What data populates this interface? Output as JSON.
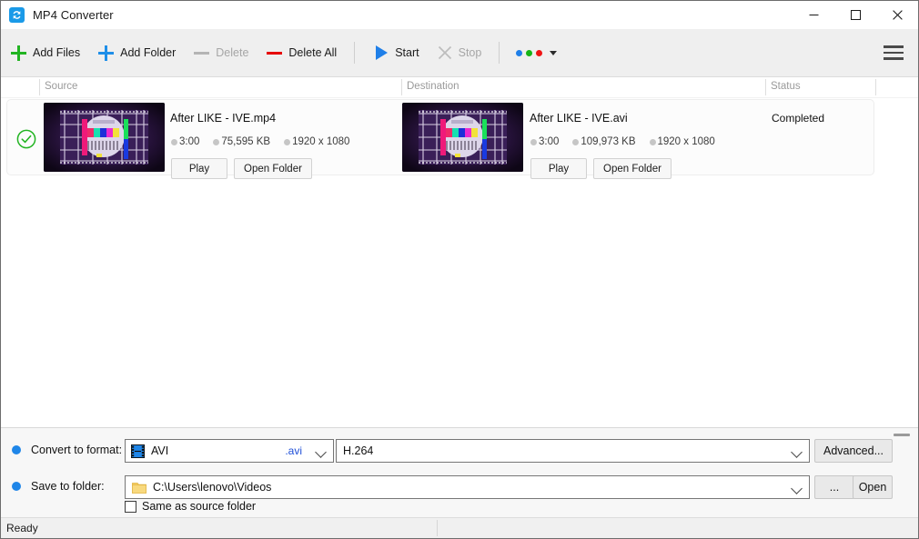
{
  "window": {
    "title": "MP4 Converter",
    "app_icon": "convert-arrows-icon",
    "minimize_label": "—",
    "maximize_label": "□",
    "close_label": "✕"
  },
  "toolbar": {
    "add_files": "Add Files",
    "add_folder": "Add Folder",
    "delete": "Delete",
    "delete_all": "Delete All",
    "start": "Start",
    "stop": "Stop",
    "dots_label": "",
    "menu_label": ""
  },
  "list": {
    "columns": [
      "Source",
      "Destination",
      "Status"
    ],
    "rows": [
      {
        "checked": true,
        "source": {
          "filename": "After LIKE - IVE.mp4",
          "duration": "3:00",
          "size": "75,595 KB",
          "resolution": "1920 x 1080",
          "play": "Play",
          "open_folder": "Open Folder"
        },
        "destination": {
          "filename": "After LIKE - IVE.avi",
          "duration": "3:00",
          "size": "109,973 KB",
          "resolution": "1920 x 1080",
          "play": "Play",
          "open_folder": "Open Folder"
        },
        "status": "Completed"
      }
    ]
  },
  "settings": {
    "format_label": "Convert to format:",
    "format_value": "AVI",
    "format_extension": ".avi",
    "codec_value": "H.264",
    "advanced_label": "Advanced...",
    "save_label": "Save to folder:",
    "save_path": "C:\\Users\\lenovo\\Videos",
    "browse_label": "...",
    "open_label": "Open",
    "same_as_source_label": "Same as source folder",
    "same_as_source_checked": false
  },
  "statusbar": {
    "text": "Ready"
  },
  "colors": {
    "accent_blue": "#1f86e8",
    "add_green": "#22b422",
    "delete_red": "#e60000",
    "success_green": "#22b422",
    "titlebar_bg": "#ffffff",
    "toolbar_bg": "#efefef",
    "panel_bg": "#f7f7f7"
  }
}
